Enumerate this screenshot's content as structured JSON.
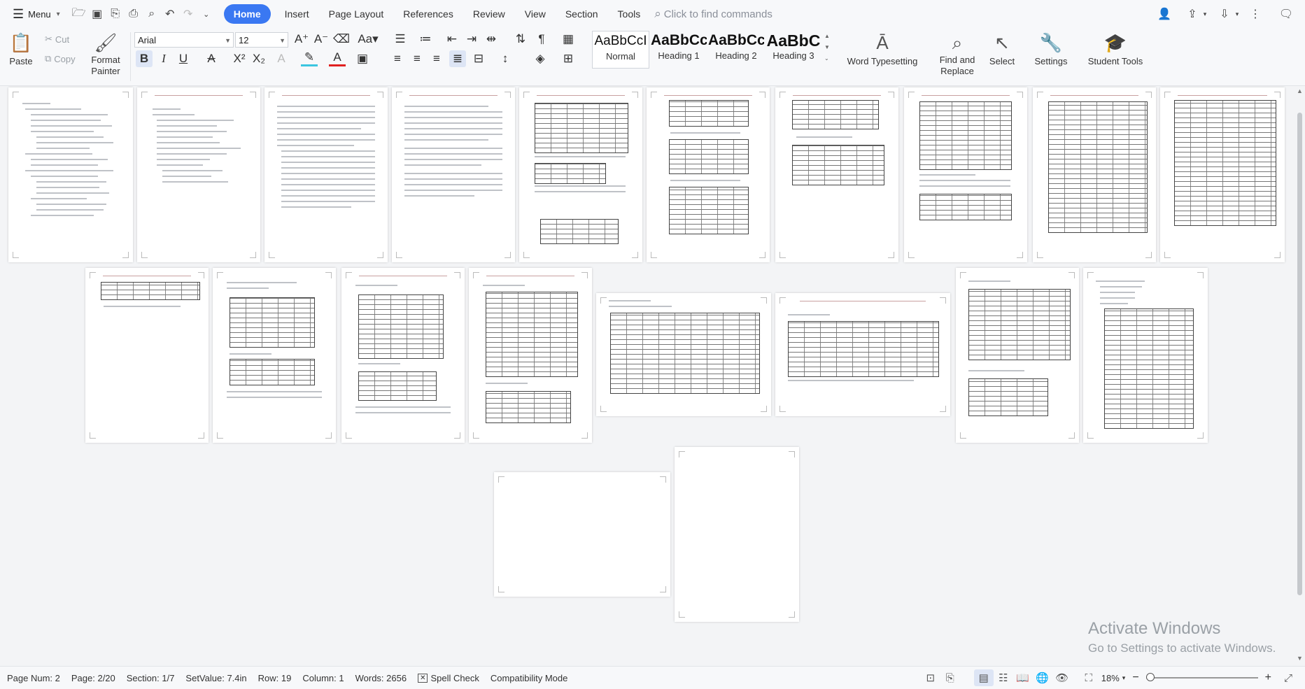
{
  "menubar": {
    "menu_label": "Menu",
    "tabs": [
      {
        "label": "Home",
        "active": true
      },
      {
        "label": "Insert"
      },
      {
        "label": "Page Layout"
      },
      {
        "label": "References"
      },
      {
        "label": "Review"
      },
      {
        "label": "View"
      },
      {
        "label": "Section"
      },
      {
        "label": "Tools"
      }
    ],
    "search_placeholder": "Click to find commands"
  },
  "ribbon": {
    "paste": "Paste",
    "cut": "Cut",
    "copy": "Copy",
    "format_painter": "Format Painter",
    "font_name": "Arial",
    "font_size": "12",
    "styles": [
      {
        "sample": "AaBbCcI",
        "name": "Normal"
      },
      {
        "sample": "AaBbCc",
        "name": "Heading 1"
      },
      {
        "sample": "AaBbCc",
        "name": "Heading 2"
      },
      {
        "sample": "AaBbC",
        "name": "Heading 3"
      }
    ],
    "word_typesetting": "Word Typesetting",
    "find_replace": "Find and Replace",
    "select": "Select",
    "settings": "Settings",
    "student_tools": "Student Tools"
  },
  "watermark": {
    "title": "Activate Windows",
    "subtitle": "Go to Settings to activate Windows."
  },
  "statusbar": {
    "page_num": "Page Num: 2",
    "page": "Page: 2/20",
    "section": "Section: 1/7",
    "set_value": "SetValue: 7.4in",
    "row": "Row: 19",
    "column": "Column: 1",
    "words": "Words: 2656",
    "spell_check": "Spell Check",
    "compat_mode": "Compatibility Mode",
    "zoom": "18%"
  },
  "colors": {
    "accent": "#3a78f2",
    "background": "#f3f4f6"
  }
}
